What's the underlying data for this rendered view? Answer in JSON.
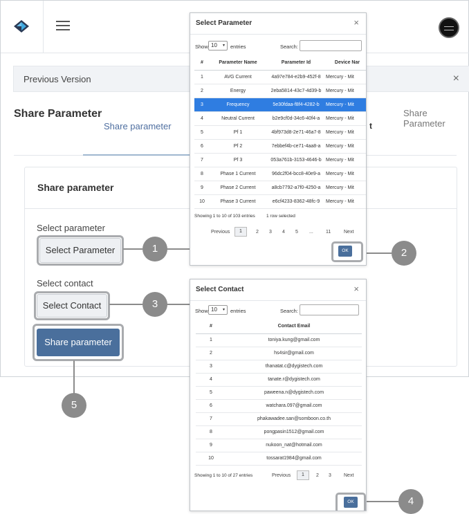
{
  "header": {
    "logo": "diamond-logo-icon",
    "menu_icon": "hamburger-icon",
    "avatar_icon": "user-avatar-icon"
  },
  "version_bar": {
    "label": "Previous Version",
    "close": "×"
  },
  "page": {
    "title": "Share Parameter",
    "breadcrumb": "Share Parameter"
  },
  "tabs": {
    "active": "Share parameter",
    "partial": "t"
  },
  "card": {
    "title": "Share parameter",
    "select_parameter_label": "Select parameter",
    "select_parameter_button": "Select Parameter",
    "select_contact_label": "Select contact",
    "select_contact_button": "Select Contact",
    "share_button": "Share parameter"
  },
  "callouts": [
    "1",
    "2",
    "3",
    "4",
    "5"
  ],
  "param_modal": {
    "title": "Select Parameter",
    "close": "×",
    "show": "Show",
    "entries_value": "10",
    "entries": "entries",
    "search": "Search:",
    "columns": [
      "#",
      "Parameter Name",
      "Parameter Id",
      "Device Nar"
    ],
    "rows": [
      [
        "1",
        "AVG Current",
        "4a97e784-e2b9-452f-8",
        "Mercury - Mit"
      ],
      [
        "2",
        "Energy",
        "2eba5814-43c7-4d39-b",
        "Mercury - Mit"
      ],
      [
        "3",
        "Frequency",
        "5e30fdaa-f8f4-4282-b",
        "Mercury - Mit"
      ],
      [
        "4",
        "Neutral Current",
        "b2e9cf0d-34c6-40f4-a",
        "Mercury - Mit"
      ],
      [
        "5",
        "Pf 1",
        "4bf973d8-2e71-46a7-8",
        "Mercury - Mit"
      ],
      [
        "6",
        "Pf 2",
        "7ebbef4b-ce71-4aa8-a",
        "Mercury - Mit"
      ],
      [
        "7",
        "Pf 3",
        "053a761b-3153-4646-b",
        "Mercury - Mit"
      ],
      [
        "8",
        "Phase 1 Current",
        "96dc2f04-bcc8-40e9-a",
        "Mercury - Mit"
      ],
      [
        "9",
        "Phase 2 Current",
        "a8cb7792-a7f0-4250-a",
        "Mercury - Mit"
      ],
      [
        "10",
        "Phase 3 Current",
        "e6cf4233-8362-48fc-9",
        "Mercury - Mit"
      ]
    ],
    "selected_row": 2,
    "info": "Showing 1 to 10 of 103 entries",
    "selection_info": "1 row selected",
    "pagination": {
      "prev": "Previous",
      "current": "1",
      "pages": [
        "2",
        "3",
        "4",
        "5",
        "...",
        "11"
      ],
      "next": "Next"
    },
    "ok": "OK"
  },
  "contact_modal": {
    "title": "Select Contact",
    "close": "×",
    "show": "Show",
    "entries_value": "10",
    "entries": "entries",
    "search": "Search:",
    "columns": [
      "#",
      "Contact Email"
    ],
    "rows": [
      [
        "1",
        "toniya.kung@gmail.com"
      ],
      [
        "2",
        "hs4sir@gmail.com"
      ],
      [
        "3",
        "thanatat.c@dygistech.com"
      ],
      [
        "4",
        "tanate.r@dygistech.com"
      ],
      [
        "5",
        "paweena.n@dygistech.com"
      ],
      [
        "6",
        "watchara.097@gmail.com"
      ],
      [
        "7",
        "phakawadee.san@somboon.co.th"
      ],
      [
        "8",
        "pongpasin1512@gmail.com"
      ],
      [
        "9",
        "nukoon_nat@hotmail.com"
      ],
      [
        "10",
        "tossarat1984@gmail.com"
      ]
    ],
    "info": "Showing 1 to 10 of 27 entries",
    "pagination": {
      "prev": "Previous",
      "current": "1",
      "pages": [
        "2",
        "3"
      ],
      "next": "Next"
    },
    "ok": "OK"
  },
  "colors": {
    "primary": "#4a6f9c",
    "selected_row": "#2f7de1",
    "callout": "#8b8b8b",
    "highlight_border": "#a9abae"
  }
}
